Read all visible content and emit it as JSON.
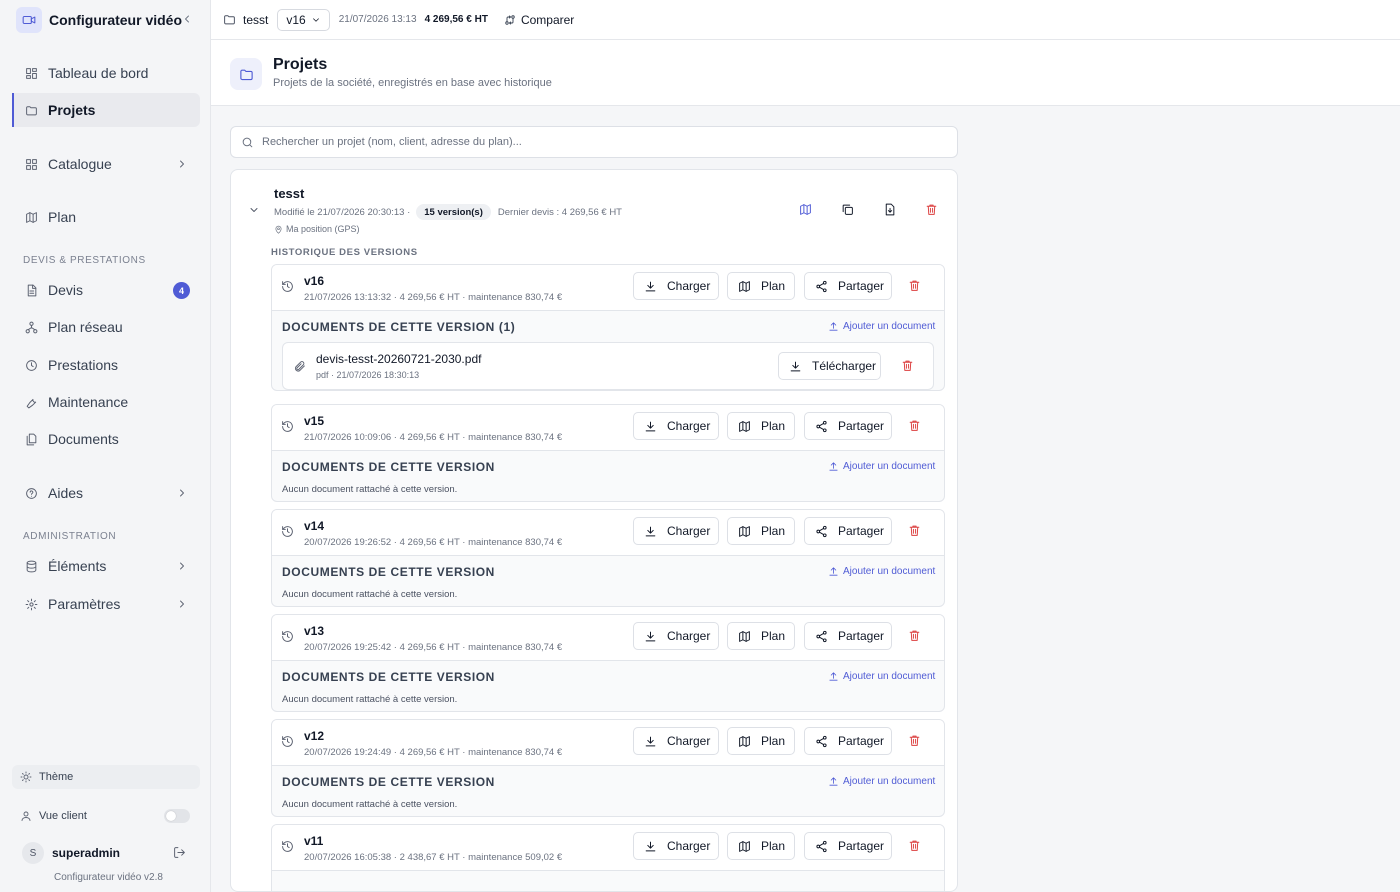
{
  "sidebar": {
    "app_title": "Configurateur vidéo",
    "nav": [
      {
        "label": "Tableau de bord"
      },
      {
        "label": "Projets"
      },
      {
        "label": "Catalogue"
      },
      {
        "label": "Plan"
      },
      {
        "label": "Devis",
        "badge": "4"
      },
      {
        "label": "Plan réseau"
      },
      {
        "label": "Prestations"
      },
      {
        "label": "Maintenance"
      },
      {
        "label": "Documents"
      },
      {
        "label": "Aides"
      },
      {
        "label": "Éléments"
      },
      {
        "label": "Paramètres"
      }
    ],
    "sections": {
      "devis": "DEVIS & PRESTATIONS",
      "admin": "ADMINISTRATION"
    },
    "theme_label": "Thème",
    "client_view_label": "Vue client",
    "client_view_on": false,
    "user_initial": "S",
    "user_name": "superadmin",
    "version": "Configurateur vidéo v2.8"
  },
  "topbar": {
    "project": "tesst",
    "version": "v16",
    "date": "21/07/2026 13:13",
    "price": "4 269,56 € HT",
    "compare": "Comparer"
  },
  "page": {
    "title": "Projets",
    "subtitle": "Projets de la société, enregistrés en base avec historique",
    "search_placeholder": "Rechercher un projet (nom, client, adresse du plan)..."
  },
  "project": {
    "name": "tesst",
    "modified": "Modifié le 21/07/2026 20:30:13 ·",
    "versions_count": "15 version(s)",
    "last_quote": "Dernier devis : 4 269,56 € HT",
    "location": "Ma position (GPS)",
    "history_label": "HISTORIQUE DES VERSIONS",
    "buttons": {
      "load": "Charger",
      "plan": "Plan",
      "share": "Partager",
      "download": "Télécharger",
      "add_doc": "Ajouter un document"
    },
    "versions": [
      {
        "name": "v16",
        "meta": "21/07/2026 13:13:32 · 4 269,56 € HT · maintenance 830,74 €",
        "docs_title": "DOCUMENTS DE CETTE VERSION (1)",
        "documents": [
          {
            "name": "devis-tesst-20260721-2030.pdf",
            "meta": "pdf · 21/07/2026 18:30:13"
          }
        ]
      },
      {
        "name": "v15",
        "meta": "21/07/2026 10:09:06 · 4 269,56 € HT · maintenance 830,74 €",
        "docs_title": "DOCUMENTS DE CETTE VERSION",
        "empty": "Aucun document rattaché à cette version."
      },
      {
        "name": "v14",
        "meta": "20/07/2026 19:26:52 · 4 269,56 € HT · maintenance 830,74 €",
        "docs_title": "DOCUMENTS DE CETTE VERSION",
        "empty": "Aucun document rattaché à cette version."
      },
      {
        "name": "v13",
        "meta": "20/07/2026 19:25:42 · 4 269,56 € HT · maintenance 830,74 €",
        "docs_title": "DOCUMENTS DE CETTE VERSION",
        "empty": "Aucun document rattaché à cette version."
      },
      {
        "name": "v12",
        "meta": "20/07/2026 19:24:49 · 4 269,56 € HT · maintenance 830,74 €",
        "docs_title": "DOCUMENTS DE CETTE VERSION",
        "empty": "Aucun document rattaché à cette version."
      },
      {
        "name": "v11",
        "meta": "20/07/2026 16:05:38 · 2 438,67 € HT · maintenance 509,02 €"
      }
    ]
  },
  "icons": [
    "video-icon",
    "chevron-left-icon",
    "dashboard-icon",
    "folder-icon",
    "grid-icon",
    "map-icon",
    "document-icon",
    "network-icon",
    "clock-icon",
    "wrench-icon",
    "documents-icon",
    "help-icon",
    "database-icon",
    "gear-icon",
    "sun-icon",
    "user-icon",
    "logout-icon",
    "search-icon",
    "history-icon",
    "download-icon",
    "share-icon",
    "trash-icon",
    "upload-icon",
    "paperclip-icon",
    "copy-icon",
    "export-icon",
    "pin-icon",
    "compare-icon"
  ],
  "colors": {
    "accent": "#4f5bd5",
    "danger": "#dc3f3f",
    "sidebar_bg": "#f4f5f7"
  }
}
